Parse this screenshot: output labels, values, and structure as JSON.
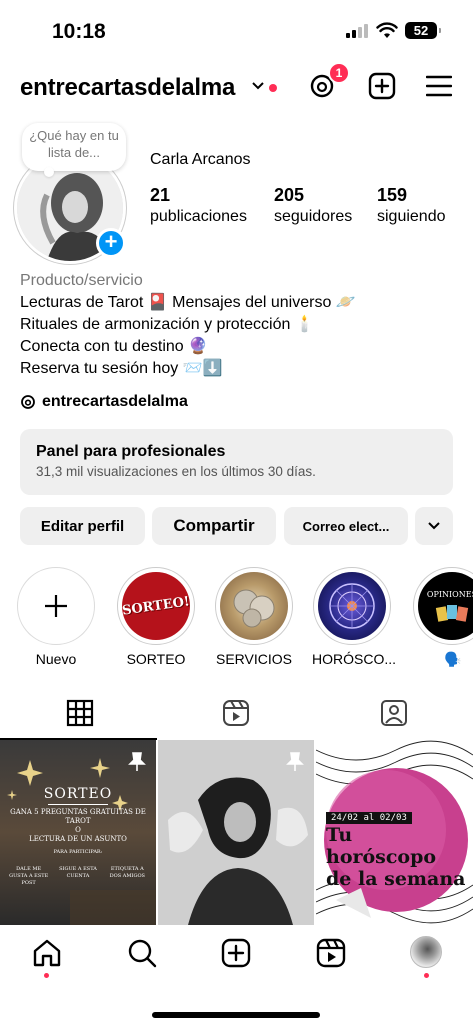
{
  "status_bar": {
    "time": "10:18",
    "battery": "52"
  },
  "header": {
    "username": "entrecartasdelalma",
    "notification_count": "1"
  },
  "profile": {
    "note": "¿Qué hay en tu lista de...",
    "display_name": "Carla Arcanos",
    "stats": [
      {
        "value": "21",
        "label": "publicaciones"
      },
      {
        "value": "205",
        "label": "seguidores"
      },
      {
        "value": "159",
        "label": "siguiendo"
      }
    ],
    "bio": {
      "category": "Producto/servicio",
      "lines": [
        "Lecturas de Tarot 🎴 Mensajes del universo 🪐",
        "Rituales de armonización y protección 🕯️",
        "Conecta con tu destino 🔮",
        "Reserva tu sesión hoy 📨⬇️"
      ]
    },
    "threads_handle": "entrecartasdelalma"
  },
  "pro_panel": {
    "title": "Panel para profesionales",
    "subtitle": "31,3 mil visualizaciones en los últimos 30 días."
  },
  "actions": {
    "edit": "Editar perfil",
    "share": "Compartir",
    "email": "Correo elect..."
  },
  "highlights": [
    {
      "label": "Nuevo",
      "sticker": ""
    },
    {
      "label": "SORTEO",
      "sticker": "SORTEO!"
    },
    {
      "label": "SERVICIOS",
      "sticker": ""
    },
    {
      "label": "HORÓSCO...",
      "sticker": ""
    },
    {
      "label": "🗣️",
      "sticker": "OPINIONES"
    }
  ],
  "posts": {
    "sorteo": {
      "title": "SORTEO",
      "line1": "GANA 5 PREGUNTAS GRATUITAS DE TAROT",
      "line2": "O",
      "line3": "LECTURA DE UN ASUNTO",
      "line4": "PARA PARTICIPAR:",
      "steps": [
        "DALE ME GUSTA A ESTE POST",
        "SIGUE A ESTA CUENTA",
        "ETIQUETA A DOS AMIGOS"
      ]
    },
    "horoscopo": {
      "dates": "24/02 al 02/03",
      "title": "Tu horóscopo de la semana"
    }
  },
  "colors": {
    "accent_blue": "#0095f6",
    "badge_red": "#ff2d55",
    "button_gray": "#efefef"
  }
}
